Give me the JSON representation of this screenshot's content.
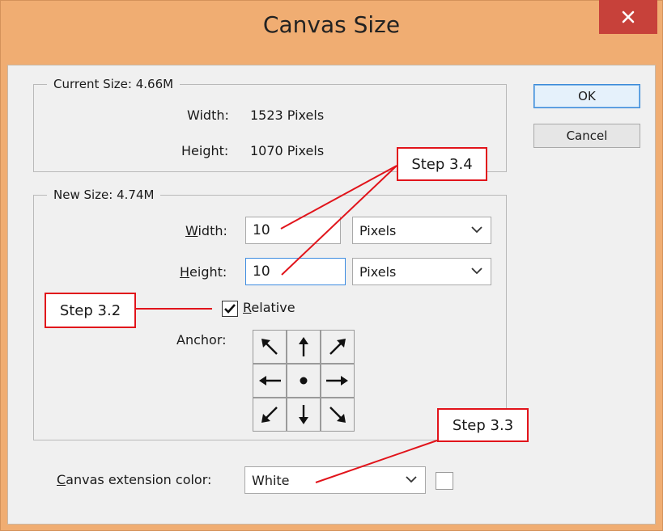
{
  "window": {
    "title": "Canvas Size",
    "close_symbol": "×"
  },
  "current_size": {
    "legend": "Current Size: 4.66M",
    "width_label": "Width:",
    "width_value": "1523 Pixels",
    "height_label": "Height:",
    "height_value": "1070 Pixels"
  },
  "new_size": {
    "legend": "New Size: 4.74M",
    "width_label_ul": "W",
    "width_label_rest": "idth:",
    "width_value": "10",
    "width_unit": "Pixels",
    "height_label_ul": "H",
    "height_label_rest": "eight:",
    "height_value": "10",
    "height_unit": "Pixels",
    "relative_ul": "R",
    "relative_rest": "elative",
    "relative_checked": true,
    "anchor_label": "Anchor:",
    "anchor_icons": [
      "arrow-up-left-icon",
      "arrow-up-icon",
      "arrow-up-right-icon",
      "arrow-left-icon",
      "center-dot-icon",
      "arrow-right-icon",
      "arrow-down-left-icon",
      "arrow-down-icon",
      "arrow-down-right-icon"
    ]
  },
  "extension": {
    "label_ul": "C",
    "label_rest": "anvas extension color:",
    "value": "White",
    "swatch_color": "#ffffff"
  },
  "buttons": {
    "ok": "OK",
    "cancel": "Cancel"
  },
  "callouts": {
    "step_3_2": "Step 3.2",
    "step_3_3": "Step 3.3",
    "step_3_4": "Step 3.4"
  },
  "colors": {
    "title_bar": "#f0ad72",
    "close_button": "#c7413a",
    "callout_border": "#e1141b",
    "focus_border": "#3c8be0"
  }
}
